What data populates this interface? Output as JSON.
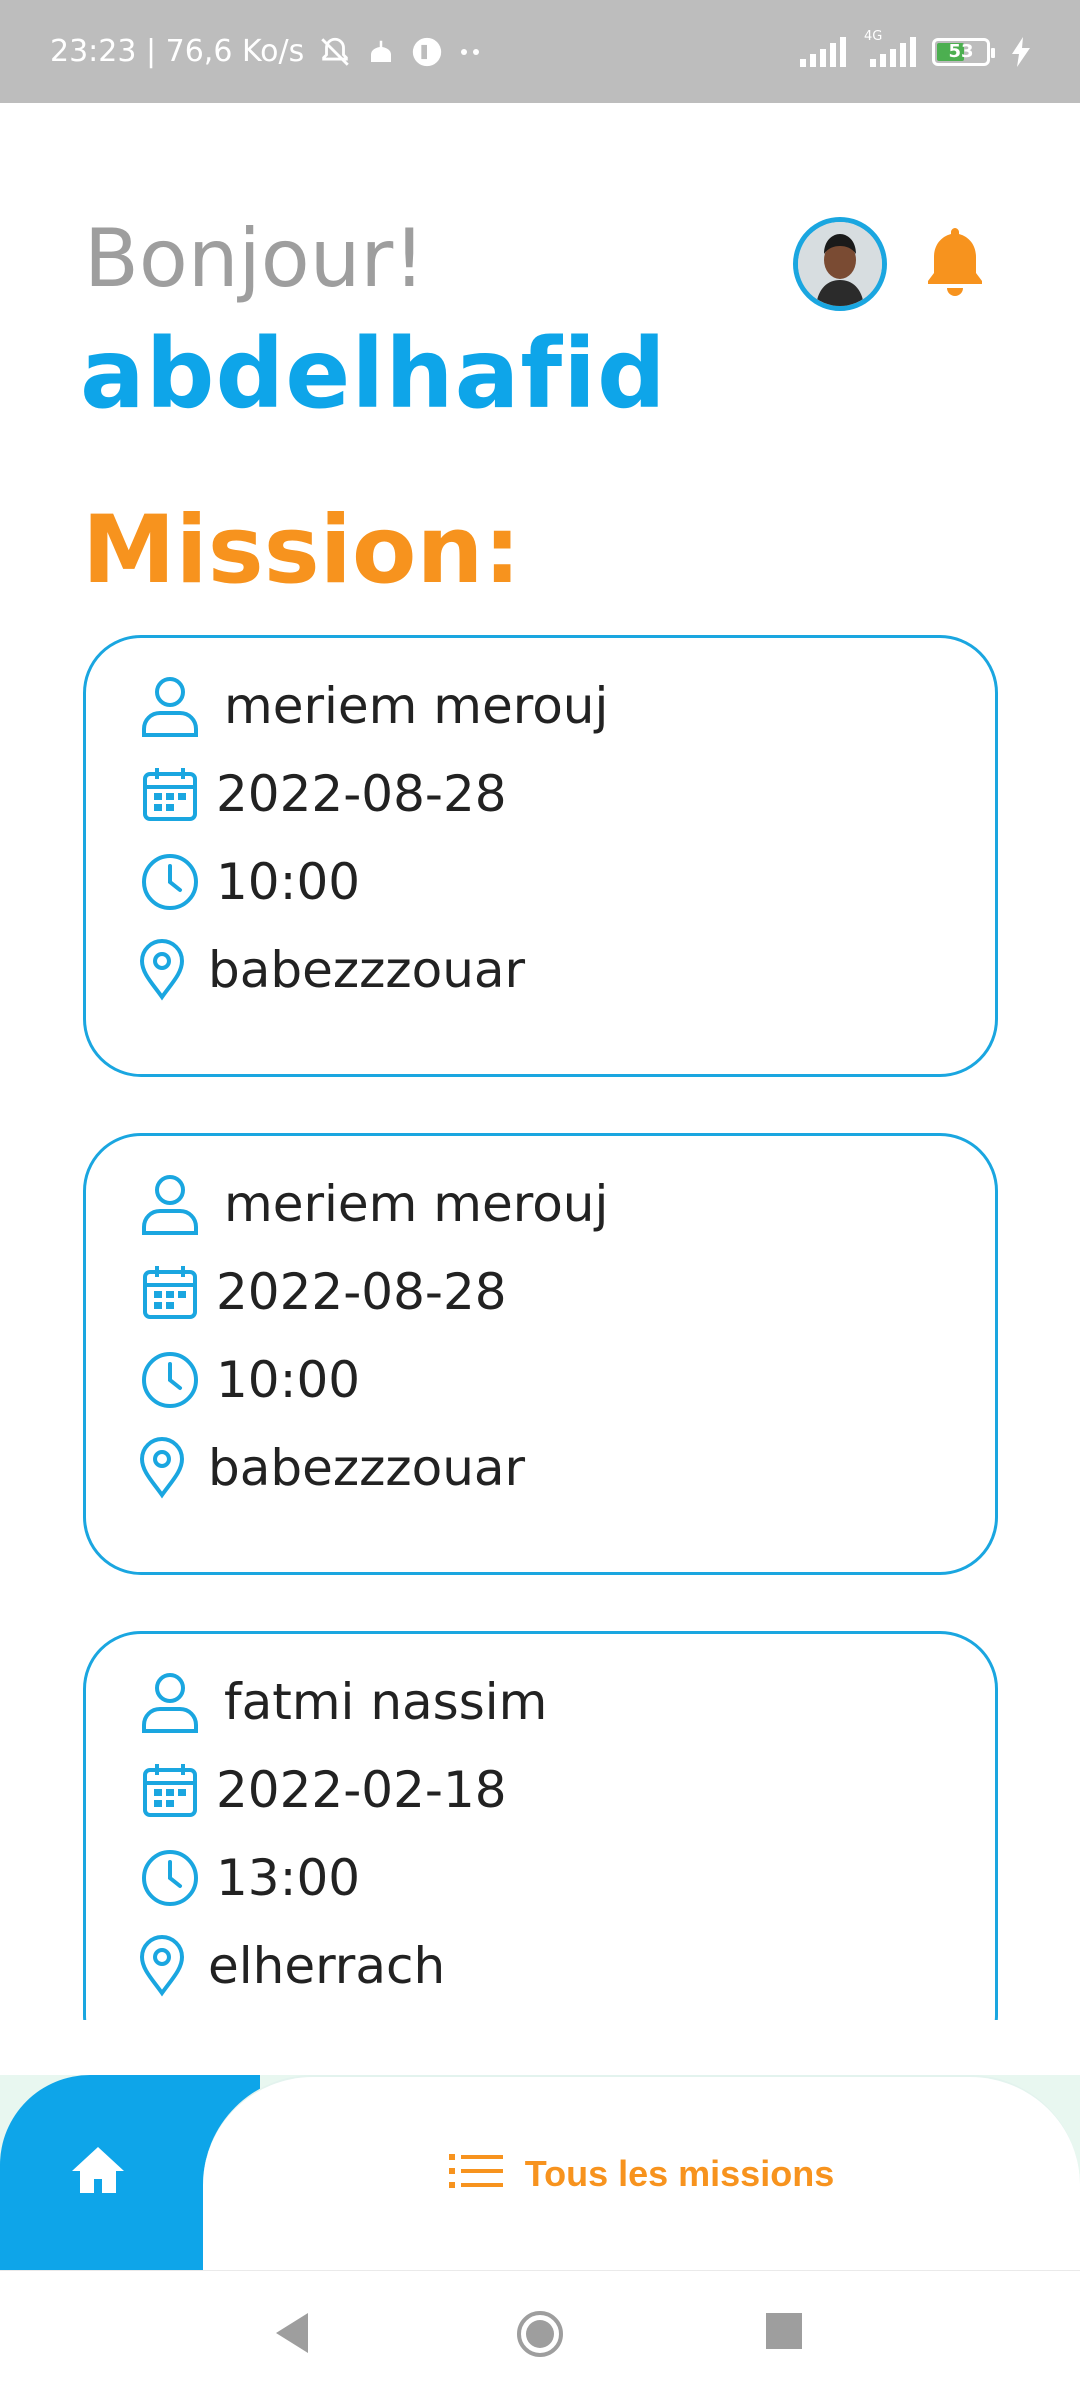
{
  "status_bar": {
    "time_speed": "23:23 | 76,6 Ko/s",
    "network": "4G",
    "battery": "53",
    "battery_level": 0.53
  },
  "header": {
    "greeting": "Bonjour!",
    "username": "abdelhafid"
  },
  "section_title": "Mission:",
  "missions": [
    {
      "client": "meriem merouj",
      "date": "2022-08-28",
      "time": "10:00",
      "location": "babezzzouar"
    },
    {
      "client": "meriem merouj",
      "date": "2022-08-28",
      "time": "10:00",
      "location": "babezzzouar"
    },
    {
      "client": "fatmi nassim",
      "date": "2022-02-18",
      "time": "13:00",
      "location": "elherrach"
    }
  ],
  "bottom_nav": {
    "missions_label": "Tous les missions"
  },
  "colors": {
    "accent_blue": "#0ea5e9",
    "accent_orange": "#f7931e",
    "muted_gray": "#9e9e9e"
  },
  "icons": [
    "person-icon",
    "calendar-icon",
    "clock-icon",
    "location-pin-icon",
    "bell-icon",
    "home-icon",
    "list-icon"
  ]
}
